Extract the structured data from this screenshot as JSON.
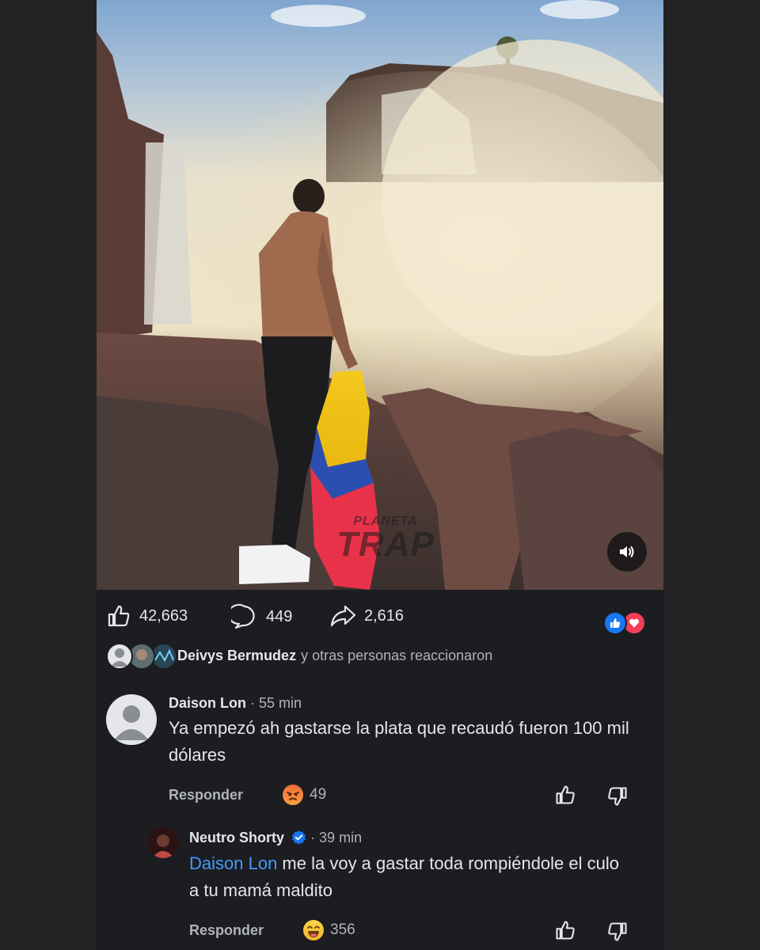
{
  "video": {
    "watermark_line1": "PLANETA",
    "watermark_line2": "TRAP"
  },
  "actions": {
    "likes": "42,663",
    "comments": "449",
    "shares": "2,616"
  },
  "reactions_summary": {
    "name": "Deivys Bermudez",
    "rest": "y otras personas reaccionaron"
  },
  "comments": [
    {
      "author": "Daison Lon",
      "time": "55 min",
      "text": "Ya empezó ah gastarse la plata que recaudó fueron 100 mil dólares",
      "reply_label": "Responder",
      "reaction_count": "49",
      "reaction_icon": "angry-emoji-icon"
    },
    {
      "author": "Neutro Shorty",
      "verified": true,
      "time": "39 min",
      "mention": "Daison Lon",
      "text": " me la voy a gastar toda rompiéndole el culo a tu mamá maldito",
      "reply_label": "Responder",
      "reaction_count": "356",
      "reaction_icon": "laughing-emoji-icon"
    }
  ],
  "colors": {
    "background": "#1c1d21",
    "text": "#e4e6eb",
    "secondary_text": "#b0b3b8",
    "mention": "#4599ff",
    "like_blue": "#1877f2",
    "love_red": "#f33e58"
  }
}
